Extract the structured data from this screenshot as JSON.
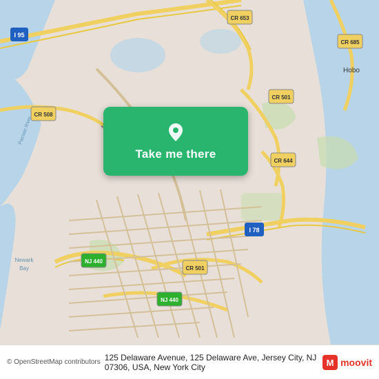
{
  "map": {
    "alt": "Map showing Jersey City, NJ area",
    "center_lat": 40.728,
    "center_lng": -74.07
  },
  "button": {
    "label": "Take me there",
    "icon": "location-pin"
  },
  "bottom_bar": {
    "copyright": "© OpenStreetMap contributors",
    "address": "125 Delaware Avenue, 125 Delaware Ave, Jersey City, NJ 07306, USA, New York City"
  },
  "moovit": {
    "text": "moovit",
    "icon_color": "#e63329"
  }
}
